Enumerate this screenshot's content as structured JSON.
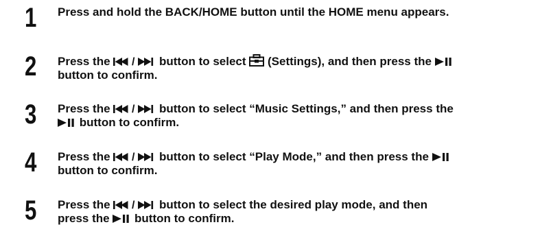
{
  "steps": [
    {
      "number": "1",
      "text": "Press and hold the BACK/HOME button until the HOME menu appears."
    },
    {
      "number": "2",
      "pre1": "Press the ",
      "mid1": " button to select ",
      "post1": " (Settings), and then press the ",
      "line2": "button to confirm."
    },
    {
      "number": "3",
      "pre1": "Press the ",
      "post1": " button to select “Music Settings,” and then press the",
      "line2": " button to confirm."
    },
    {
      "number": "4",
      "pre1": "Press the ",
      "post1": " button to select “Play Mode,” and then press the ",
      "line2": "button to confirm."
    },
    {
      "number": "5",
      "pre1": "Press the ",
      "post1": " button to select the desired play mode, and then",
      "line2a": "press the ",
      "line2b": " button to confirm."
    }
  ],
  "icons": {
    "prev_next": "prev-next-buttons-icon",
    "play_pause": "play-pause-icon",
    "settings": "settings-toolbox-icon"
  }
}
